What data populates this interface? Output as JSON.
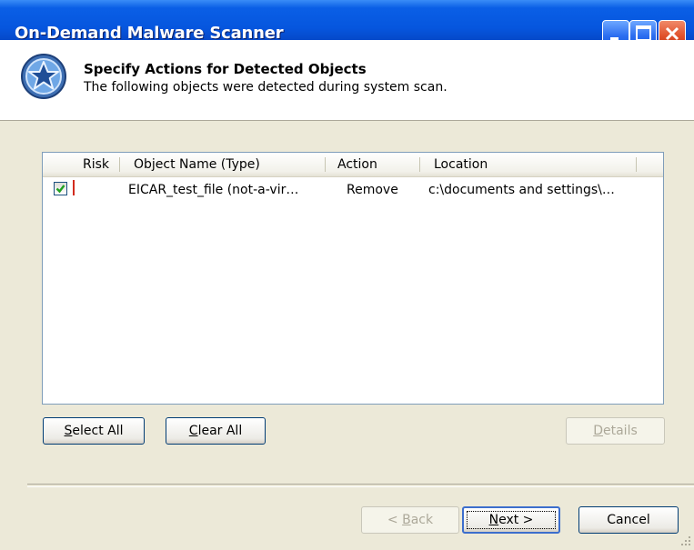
{
  "window": {
    "title": "On-Demand Malware Scanner",
    "controls": {
      "minimize": "minimize-icon",
      "maximize": "maximize-icon",
      "close": "close-icon"
    }
  },
  "header": {
    "title": "Specify Actions for Detected Objects",
    "subtitle": "The following objects were detected during system scan.",
    "logo_icon": "star-shield-icon"
  },
  "list": {
    "columns": [
      "Risk",
      "Object Name (Type)",
      "Action",
      "Location"
    ],
    "rows": [
      {
        "checked": true,
        "risk_color": "#d22b1d",
        "object_name": "EICAR_test_file (not-a-vir…",
        "action": "Remove",
        "location": "c:\\documents and settings\\…"
      }
    ]
  },
  "buttons": {
    "select_all": {
      "accel": "S",
      "rest": "elect All"
    },
    "clear_all": {
      "accel": "C",
      "rest": "lear All"
    },
    "details": {
      "accel": "D",
      "rest": "etails"
    },
    "back": {
      "prefix": "< ",
      "accel": "B",
      "rest": "ack"
    },
    "next": {
      "accel": "N",
      "rest": "ext >"
    },
    "cancel": "Cancel"
  },
  "colors": {
    "titlebar": "#0a5fe6",
    "dialog_bg": "#ece9d8",
    "checkbox_check": "#21a121",
    "risk_high": "#d22b1d"
  }
}
